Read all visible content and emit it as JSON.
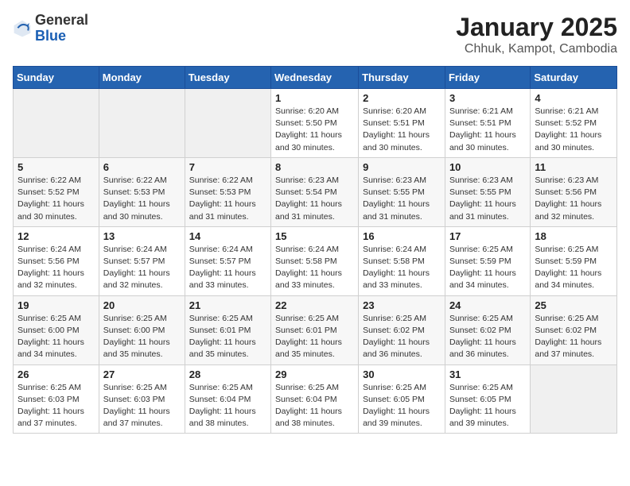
{
  "header": {
    "logo_general": "General",
    "logo_blue": "Blue",
    "title": "January 2025",
    "subtitle": "Chhuk, Kampot, Cambodia"
  },
  "days_of_week": [
    "Sunday",
    "Monday",
    "Tuesday",
    "Wednesday",
    "Thursday",
    "Friday",
    "Saturday"
  ],
  "weeks": [
    [
      {
        "day": "",
        "sunrise": "",
        "sunset": "",
        "daylight": ""
      },
      {
        "day": "",
        "sunrise": "",
        "sunset": "",
        "daylight": ""
      },
      {
        "day": "",
        "sunrise": "",
        "sunset": "",
        "daylight": ""
      },
      {
        "day": "1",
        "sunrise": "Sunrise: 6:20 AM",
        "sunset": "Sunset: 5:50 PM",
        "daylight": "Daylight: 11 hours and 30 minutes."
      },
      {
        "day": "2",
        "sunrise": "Sunrise: 6:20 AM",
        "sunset": "Sunset: 5:51 PM",
        "daylight": "Daylight: 11 hours and 30 minutes."
      },
      {
        "day": "3",
        "sunrise": "Sunrise: 6:21 AM",
        "sunset": "Sunset: 5:51 PM",
        "daylight": "Daylight: 11 hours and 30 minutes."
      },
      {
        "day": "4",
        "sunrise": "Sunrise: 6:21 AM",
        "sunset": "Sunset: 5:52 PM",
        "daylight": "Daylight: 11 hours and 30 minutes."
      }
    ],
    [
      {
        "day": "5",
        "sunrise": "Sunrise: 6:22 AM",
        "sunset": "Sunset: 5:52 PM",
        "daylight": "Daylight: 11 hours and 30 minutes."
      },
      {
        "day": "6",
        "sunrise": "Sunrise: 6:22 AM",
        "sunset": "Sunset: 5:53 PM",
        "daylight": "Daylight: 11 hours and 30 minutes."
      },
      {
        "day": "7",
        "sunrise": "Sunrise: 6:22 AM",
        "sunset": "Sunset: 5:53 PM",
        "daylight": "Daylight: 11 hours and 31 minutes."
      },
      {
        "day": "8",
        "sunrise": "Sunrise: 6:23 AM",
        "sunset": "Sunset: 5:54 PM",
        "daylight": "Daylight: 11 hours and 31 minutes."
      },
      {
        "day": "9",
        "sunrise": "Sunrise: 6:23 AM",
        "sunset": "Sunset: 5:55 PM",
        "daylight": "Daylight: 11 hours and 31 minutes."
      },
      {
        "day": "10",
        "sunrise": "Sunrise: 6:23 AM",
        "sunset": "Sunset: 5:55 PM",
        "daylight": "Daylight: 11 hours and 31 minutes."
      },
      {
        "day": "11",
        "sunrise": "Sunrise: 6:23 AM",
        "sunset": "Sunset: 5:56 PM",
        "daylight": "Daylight: 11 hours and 32 minutes."
      }
    ],
    [
      {
        "day": "12",
        "sunrise": "Sunrise: 6:24 AM",
        "sunset": "Sunset: 5:56 PM",
        "daylight": "Daylight: 11 hours and 32 minutes."
      },
      {
        "day": "13",
        "sunrise": "Sunrise: 6:24 AM",
        "sunset": "Sunset: 5:57 PM",
        "daylight": "Daylight: 11 hours and 32 minutes."
      },
      {
        "day": "14",
        "sunrise": "Sunrise: 6:24 AM",
        "sunset": "Sunset: 5:57 PM",
        "daylight": "Daylight: 11 hours and 33 minutes."
      },
      {
        "day": "15",
        "sunrise": "Sunrise: 6:24 AM",
        "sunset": "Sunset: 5:58 PM",
        "daylight": "Daylight: 11 hours and 33 minutes."
      },
      {
        "day": "16",
        "sunrise": "Sunrise: 6:24 AM",
        "sunset": "Sunset: 5:58 PM",
        "daylight": "Daylight: 11 hours and 33 minutes."
      },
      {
        "day": "17",
        "sunrise": "Sunrise: 6:25 AM",
        "sunset": "Sunset: 5:59 PM",
        "daylight": "Daylight: 11 hours and 34 minutes."
      },
      {
        "day": "18",
        "sunrise": "Sunrise: 6:25 AM",
        "sunset": "Sunset: 5:59 PM",
        "daylight": "Daylight: 11 hours and 34 minutes."
      }
    ],
    [
      {
        "day": "19",
        "sunrise": "Sunrise: 6:25 AM",
        "sunset": "Sunset: 6:00 PM",
        "daylight": "Daylight: 11 hours and 34 minutes."
      },
      {
        "day": "20",
        "sunrise": "Sunrise: 6:25 AM",
        "sunset": "Sunset: 6:00 PM",
        "daylight": "Daylight: 11 hours and 35 minutes."
      },
      {
        "day": "21",
        "sunrise": "Sunrise: 6:25 AM",
        "sunset": "Sunset: 6:01 PM",
        "daylight": "Daylight: 11 hours and 35 minutes."
      },
      {
        "day": "22",
        "sunrise": "Sunrise: 6:25 AM",
        "sunset": "Sunset: 6:01 PM",
        "daylight": "Daylight: 11 hours and 35 minutes."
      },
      {
        "day": "23",
        "sunrise": "Sunrise: 6:25 AM",
        "sunset": "Sunset: 6:02 PM",
        "daylight": "Daylight: 11 hours and 36 minutes."
      },
      {
        "day": "24",
        "sunrise": "Sunrise: 6:25 AM",
        "sunset": "Sunset: 6:02 PM",
        "daylight": "Daylight: 11 hours and 36 minutes."
      },
      {
        "day": "25",
        "sunrise": "Sunrise: 6:25 AM",
        "sunset": "Sunset: 6:02 PM",
        "daylight": "Daylight: 11 hours and 37 minutes."
      }
    ],
    [
      {
        "day": "26",
        "sunrise": "Sunrise: 6:25 AM",
        "sunset": "Sunset: 6:03 PM",
        "daylight": "Daylight: 11 hours and 37 minutes."
      },
      {
        "day": "27",
        "sunrise": "Sunrise: 6:25 AM",
        "sunset": "Sunset: 6:03 PM",
        "daylight": "Daylight: 11 hours and 37 minutes."
      },
      {
        "day": "28",
        "sunrise": "Sunrise: 6:25 AM",
        "sunset": "Sunset: 6:04 PM",
        "daylight": "Daylight: 11 hours and 38 minutes."
      },
      {
        "day": "29",
        "sunrise": "Sunrise: 6:25 AM",
        "sunset": "Sunset: 6:04 PM",
        "daylight": "Daylight: 11 hours and 38 minutes."
      },
      {
        "day": "30",
        "sunrise": "Sunrise: 6:25 AM",
        "sunset": "Sunset: 6:05 PM",
        "daylight": "Daylight: 11 hours and 39 minutes."
      },
      {
        "day": "31",
        "sunrise": "Sunrise: 6:25 AM",
        "sunset": "Sunset: 6:05 PM",
        "daylight": "Daylight: 11 hours and 39 minutes."
      },
      {
        "day": "",
        "sunrise": "",
        "sunset": "",
        "daylight": ""
      }
    ]
  ]
}
